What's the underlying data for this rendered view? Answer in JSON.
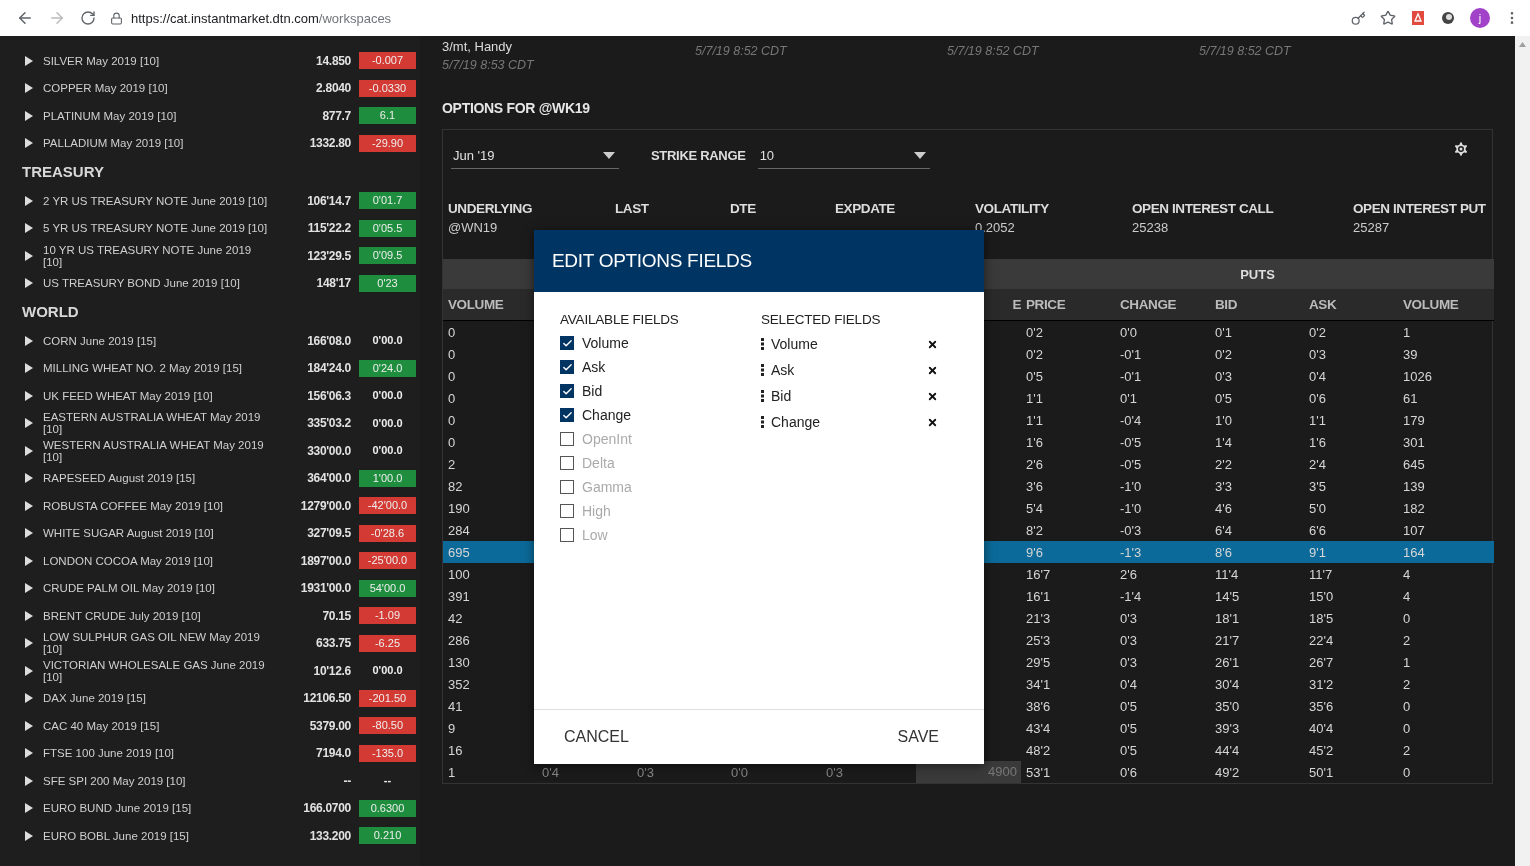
{
  "browser": {
    "url_host": "https://cat.instantmarket.dtn.com",
    "url_path": "/workspaces",
    "profile_initial": "j"
  },
  "sidebar": {
    "groups": [
      {
        "items": [
          {
            "name": "SILVER May 2019 [10]",
            "price": "14.850",
            "change": "-0.007",
            "color": "#d23a33"
          },
          {
            "name": "COPPER May 2019 [10]",
            "price": "2.8040",
            "change": "-0.0330",
            "color": "#d23a33"
          },
          {
            "name": "PLATINUM May 2019 [10]",
            "price": "877.7",
            "change": "6.1",
            "color": "#1e8e3e"
          },
          {
            "name": "PALLADIUM May 2019 [10]",
            "price": "1332.80",
            "change": "-29.90",
            "color": "#d23a33"
          }
        ]
      },
      {
        "title": "TREASURY",
        "items": [
          {
            "name": "2 YR US TREASURY NOTE June 2019 [10]",
            "price": "106'14.7",
            "change": "0'01.7",
            "color": "#1e8e3e"
          },
          {
            "name": "5 YR US TREASURY NOTE June 2019 [10]",
            "price": "115'22.2",
            "change": "0'05.5",
            "color": "#1e8e3e"
          },
          {
            "name": "10 YR US TREASURY NOTE June 2019 [10]",
            "price": "123'29.5",
            "change": "0'09.5",
            "color": "#1e8e3e"
          },
          {
            "name": "US TREASURY BOND June 2019 [10]",
            "price": "148'17",
            "change": "0'23",
            "color": "#1e8e3e"
          }
        ]
      },
      {
        "title": "WORLD",
        "items": [
          {
            "name": "CORN June 2019 [15]",
            "price": "166'08.0",
            "change": "0'00.0"
          },
          {
            "name": "MILLING WHEAT NO. 2 May 2019 [15]",
            "price": "184'24.0",
            "change": "0'24.0",
            "color": "#1e8e3e"
          },
          {
            "name": "UK FEED WHEAT May 2019 [10]",
            "price": "156'06.3",
            "change": "0'00.0"
          },
          {
            "name": "EASTERN AUSTRALIA WHEAT May 2019 [10]",
            "price": "335'03.2",
            "change": "0'00.0"
          },
          {
            "name": "WESTERN AUSTRALIA WHEAT May 2019 [10]",
            "price": "330'00.0",
            "change": "0'00.0"
          },
          {
            "name": "RAPESEED August 2019 [15]",
            "price": "364'00.0",
            "change": "1'00.0",
            "color": "#1e8e3e"
          },
          {
            "name": "ROBUSTA COFFEE May 2019 [10]",
            "price": "1279'00.0",
            "change": "-42'00.0",
            "color": "#d23a33"
          },
          {
            "name": "WHITE SUGAR August 2019 [10]",
            "price": "327'09.5",
            "change": "-0'28.6",
            "color": "#d23a33"
          },
          {
            "name": "LONDON COCOA May 2019 [10]",
            "price": "1897'00.0",
            "change": "-25'00.0",
            "color": "#d23a33"
          },
          {
            "name": "CRUDE PALM OIL May 2019 [10]",
            "price": "1931'00.0",
            "change": "54'00.0",
            "color": "#1e8e3e"
          },
          {
            "name": "BRENT CRUDE July 2019 [10]",
            "price": "70.15",
            "change": "-1.09",
            "color": "#d23a33"
          },
          {
            "name": "LOW SULPHUR GAS OIL NEW May 2019 [10]",
            "price": "633.75",
            "change": "-6.25",
            "color": "#d23a33"
          },
          {
            "name": "VICTORIAN WHOLESALE GAS June 2019 [10]",
            "price": "10'12.6",
            "change": "0'00.0"
          },
          {
            "name": "DAX June 2019 [15]",
            "price": "12106.50",
            "change": "-201.50",
            "color": "#d23a33"
          },
          {
            "name": "CAC 40 May 2019 [15]",
            "price": "5379.00",
            "change": "-80.50",
            "color": "#d23a33"
          },
          {
            "name": "FTSE 100 June 2019 [10]",
            "price": "7194.0",
            "change": "-135.0",
            "color": "#d23a33"
          },
          {
            "name": "SFE SPI 200 May 2019 [10]",
            "price": "--",
            "change": "--"
          },
          {
            "name": "EURO BUND June 2019 [15]",
            "price": "166.0700",
            "change": "0.6300",
            "color": "#1e8e3e"
          },
          {
            "name": "EURO BOBL June 2019 [15]",
            "price": "133.200",
            "change": "0.210",
            "color": "#1e8e3e"
          }
        ]
      }
    ]
  },
  "top_info": {
    "label": "3/mt, Handy",
    "time": "5/7/19 8:53 CDT",
    "times": [
      "5/7/19 8:52 CDT",
      "5/7/19 8:52 CDT",
      "5/7/19 8:52 CDT"
    ]
  },
  "options_title": "OPTIONS FOR @WK19",
  "controls": {
    "month": "Jun '19",
    "strike_label": "STRIKE RANGE",
    "strike_range": "10"
  },
  "underlying": [
    {
      "label": "UNDERLYING",
      "value": "@WN19"
    },
    {
      "label": "LAST"
    },
    {
      "label": "DTE"
    },
    {
      "label": "EXPDATE"
    },
    {
      "label": "VOLATILITY",
      "value": "0.2052"
    },
    {
      "label": "OPEN INTEREST CALL",
      "value": "25238"
    },
    {
      "label": "OPEN INTEREST PUT",
      "value": "25287"
    }
  ],
  "calls": {
    "header_left": "VOLUME",
    "header_right": "E",
    "rows": [
      {
        "volume": "0",
        "selected": false
      },
      {
        "volume": "0",
        "selected": false
      },
      {
        "volume": "0",
        "selected": false
      },
      {
        "volume": "0",
        "selected": false
      },
      {
        "volume": "0",
        "selected": false
      },
      {
        "volume": "0",
        "selected": false
      },
      {
        "volume": "2",
        "selected": false
      },
      {
        "volume": "82",
        "selected": false
      },
      {
        "volume": "190",
        "selected": false
      },
      {
        "volume": "284",
        "selected": false
      },
      {
        "volume": "695",
        "selected": true
      },
      {
        "volume": "100",
        "selected": false
      },
      {
        "volume": "391",
        "selected": false
      },
      {
        "volume": "42",
        "selected": false
      },
      {
        "volume": "286",
        "selected": false
      },
      {
        "volume": "130",
        "selected": false
      },
      {
        "volume": "352",
        "selected": false
      },
      {
        "volume": "41",
        "selected": false
      },
      {
        "volume": "9",
        "selected": false
      },
      {
        "volume": "16",
        "selected": false
      },
      {
        "volume": "1",
        "selected": false,
        "cells": [
          "0'4",
          "0'3",
          "0'0",
          "0'3"
        ],
        "strike": "4900"
      }
    ]
  },
  "puts": {
    "title": "PUTS",
    "columns": [
      "PRICE",
      "CHANGE",
      "BID",
      "ASK",
      "VOLUME"
    ],
    "rows": [
      {
        "cells": [
          "0'2",
          "0'0",
          "0'1",
          "0'2",
          "1"
        ],
        "selected": false
      },
      {
        "cells": [
          "0'2",
          "-0'1",
          "0'2",
          "0'3",
          "39"
        ],
        "selected": false
      },
      {
        "cells": [
          "0'5",
          "-0'1",
          "0'3",
          "0'4",
          "1026"
        ],
        "selected": false
      },
      {
        "cells": [
          "1'1",
          "0'1",
          "0'5",
          "0'6",
          "61"
        ],
        "selected": false
      },
      {
        "cells": [
          "1'1",
          "-0'4",
          "1'0",
          "1'1",
          "179"
        ],
        "selected": false
      },
      {
        "cells": [
          "1'6",
          "-0'5",
          "1'4",
          "1'6",
          "301"
        ],
        "selected": false
      },
      {
        "cells": [
          "2'6",
          "-0'5",
          "2'2",
          "2'4",
          "645"
        ],
        "selected": false
      },
      {
        "cells": [
          "3'6",
          "-1'0",
          "3'3",
          "3'5",
          "139"
        ],
        "selected": false
      },
      {
        "cells": [
          "5'4",
          "-1'0",
          "4'6",
          "5'0",
          "182"
        ],
        "selected": false
      },
      {
        "cells": [
          "8'2",
          "-0'3",
          "6'4",
          "6'6",
          "107"
        ],
        "selected": false
      },
      {
        "cells": [
          "9'6",
          "-1'3",
          "8'6",
          "9'1",
          "164"
        ],
        "selected": true
      },
      {
        "cells": [
          "16'7",
          "2'6",
          "11'4",
          "11'7",
          "4"
        ],
        "selected": false
      },
      {
        "cells": [
          "16'1",
          "-1'4",
          "14'5",
          "15'0",
          "4"
        ],
        "selected": false
      },
      {
        "cells": [
          "21'3",
          "0'3",
          "18'1",
          "18'5",
          "0"
        ],
        "selected": false
      },
      {
        "cells": [
          "25'3",
          "0'3",
          "21'7",
          "22'4",
          "2"
        ],
        "selected": false
      },
      {
        "cells": [
          "29'5",
          "0'3",
          "26'1",
          "26'7",
          "1"
        ],
        "selected": false
      },
      {
        "cells": [
          "34'1",
          "0'4",
          "30'4",
          "31'2",
          "2"
        ],
        "selected": false
      },
      {
        "cells": [
          "38'6",
          "0'5",
          "35'0",
          "35'6",
          "0"
        ],
        "selected": false
      },
      {
        "cells": [
          "43'4",
          "0'5",
          "39'3",
          "40'4",
          "0"
        ],
        "selected": false
      },
      {
        "cells": [
          "48'2",
          "0'5",
          "44'4",
          "45'2",
          "2"
        ],
        "selected": false
      },
      {
        "cells": [
          "53'1",
          "0'6",
          "49'2",
          "50'1",
          "0"
        ],
        "selected": false
      }
    ]
  },
  "dialog": {
    "title": "EDIT OPTIONS FIELDS",
    "available_title": "AVAILABLE FIELDS",
    "selected_title": "SELECTED FIELDS",
    "available": [
      {
        "label": "Volume",
        "checked": true
      },
      {
        "label": "Ask",
        "checked": true
      },
      {
        "label": "Bid",
        "checked": true
      },
      {
        "label": "Change",
        "checked": true
      },
      {
        "label": "OpenInt",
        "checked": false
      },
      {
        "label": "Delta",
        "checked": false
      },
      {
        "label": "Gamma",
        "checked": false
      },
      {
        "label": "High",
        "checked": false
      },
      {
        "label": "Low",
        "checked": false
      }
    ],
    "selected": [
      "Volume",
      "Ask",
      "Bid",
      "Change"
    ],
    "buttons": {
      "cancel": "CANCEL",
      "save": "SAVE"
    }
  }
}
